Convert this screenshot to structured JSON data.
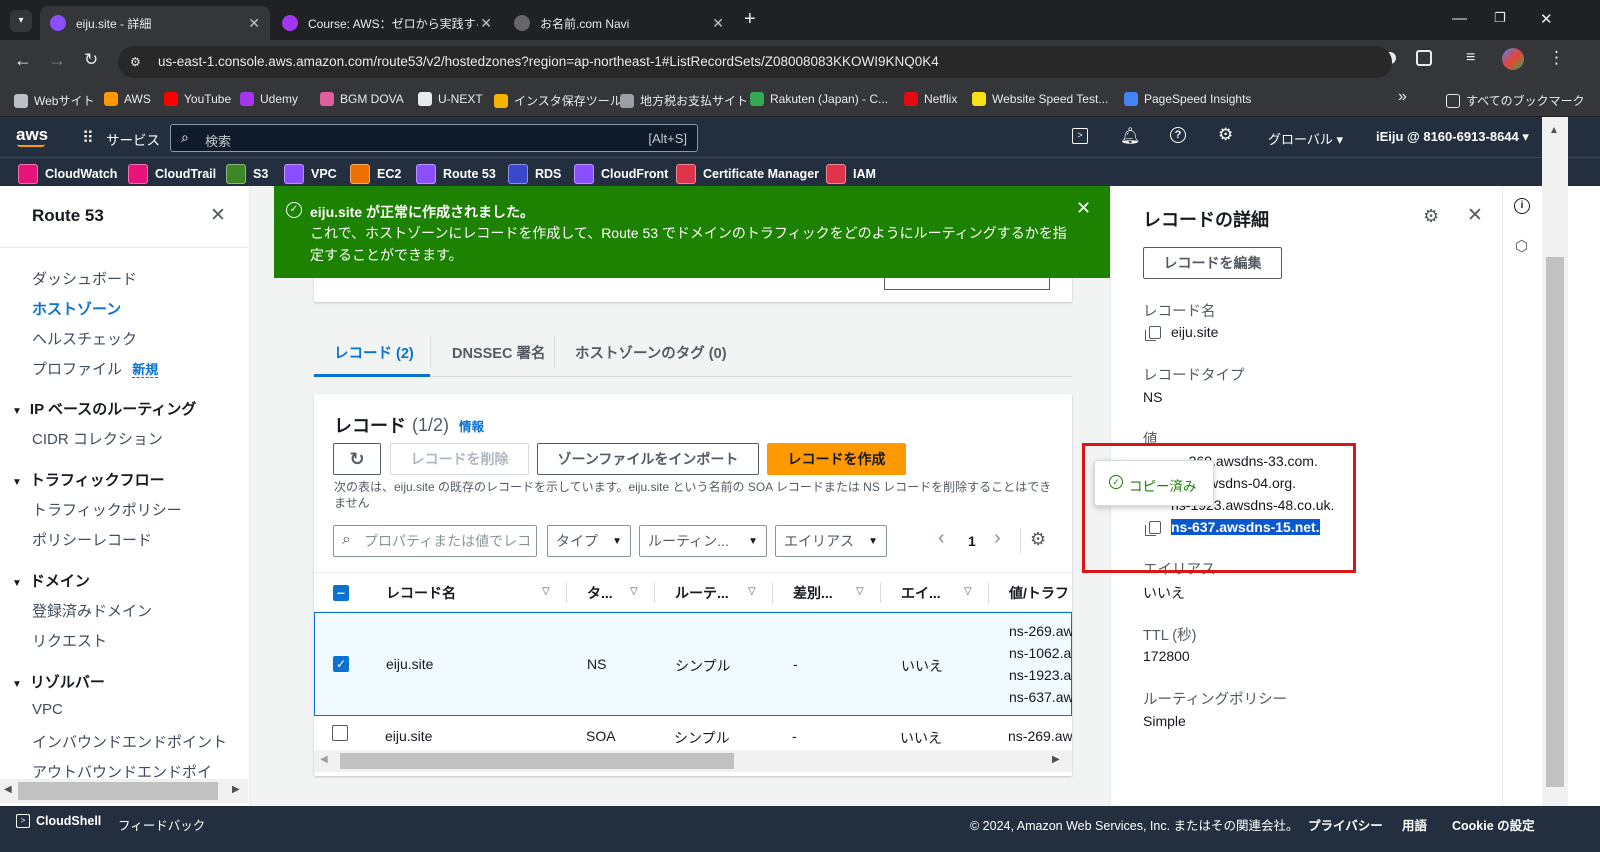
{
  "browser": {
    "tabs": [
      {
        "title": "eiju.site - 詳細",
        "color": "#8c4fff"
      },
      {
        "title": "Course: AWS：ゼロから実践するA",
        "color": "#a435f0"
      },
      {
        "title": "お名前.com Navi",
        "color": "#555"
      }
    ],
    "new_tab": "+",
    "url": "us-east-1.console.aws.amazon.com/route53/v2/hostedzones?region=ap-northeast-1#ListRecordSets/Z08008083KKOWI9KNQ0K4",
    "bookmarks": [
      {
        "label": "Webサイト",
        "color": "#bdc1c6"
      },
      {
        "label": "AWS",
        "color": "#ff9900"
      },
      {
        "label": "YouTube",
        "color": "#ff0000"
      },
      {
        "label": "Udemy",
        "color": "#a435f0"
      },
      {
        "label": "BGM DOVA",
        "color": "#e0609f"
      },
      {
        "label": "U-NEXT",
        "color": "#e8eaed"
      },
      {
        "label": "インスタ保存ツール",
        "color": "#f5b400"
      },
      {
        "label": "地方税お支払サイト",
        "color": "#9aa0a6"
      },
      {
        "label": "Rakuten (Japan) - C...",
        "color": "#34a853"
      },
      {
        "label": "Netflix",
        "color": "#e50914"
      },
      {
        "label": "Website Speed Test...",
        "color": "#f7e017"
      },
      {
        "label": "PageSpeed Insights",
        "color": "#4285f4"
      }
    ],
    "bookmarks_overflow": "»",
    "all_bookmarks": "すべてのブックマーク"
  },
  "aws": {
    "logo": "aws",
    "services_label": "サービス",
    "search_placeholder": "検索",
    "search_shortcut": "[Alt+S]",
    "region": "グローバル ▾",
    "account": "iEiju @ 8160-6913-8644 ▾",
    "favorites": [
      {
        "label": "CloudWatch",
        "color": "#e7157b"
      },
      {
        "label": "CloudTrail",
        "color": "#e7157b"
      },
      {
        "label": "S3",
        "color": "#3f8624"
      },
      {
        "label": "VPC",
        "color": "#8c4fff"
      },
      {
        "label": "EC2",
        "color": "#ed7100"
      },
      {
        "label": "Route 53",
        "color": "#8c4fff"
      },
      {
        "label": "RDS",
        "color": "#3b48cc"
      },
      {
        "label": "CloudFront",
        "color": "#8c4fff"
      },
      {
        "label": "Certificate Manager",
        "color": "#dd344c"
      },
      {
        "label": "IAM",
        "color": "#dd344c"
      }
    ]
  },
  "sidebar": {
    "title": "Route 53",
    "items": [
      "ダッシュボード",
      "ホストゾーン",
      "ヘルスチェック",
      "プロファイル"
    ],
    "new_badge": "新規",
    "sections": [
      {
        "title": "IP ベースのルーティング",
        "items": [
          "CIDR コレクション"
        ]
      },
      {
        "title": "トラフィックフロー",
        "items": [
          "トラフィックポリシー",
          "ポリシーレコード"
        ]
      },
      {
        "title": "ドメイン",
        "items": [
          "登録済みドメイン",
          "リクエスト"
        ]
      },
      {
        "title": "リゾルバー",
        "items": [
          "VPC",
          "インバウンドエンドポイント",
          "アウトバウンドエンドポイン"
        ]
      }
    ]
  },
  "flash": {
    "title": "eiju.site が正常に作成されました。",
    "body": "これで、ホストゾーンにレコードを作成して、Route 53 でドメインのトラフィックをどのようにルーティングするかを指定することができます。"
  },
  "tabs": [
    "レコード (2)",
    "DNSSEC 署名",
    "ホストゾーンのタグ (0)"
  ],
  "records": {
    "title": "レコード",
    "count": "(1/2)",
    "info": "情報",
    "refresh": "↻",
    "delete": "レコードを削除",
    "import": "ゾーンファイルをインポート",
    "create": "レコードを作成",
    "description": "次の表は、eiju.site の既存のレコードを示しています。eiju.site という名前の SOA レコードまたは NS レコードを削除することはできません",
    "filter_placeholder": "プロパティまたは値でレコ",
    "filter_type": "タイプ",
    "filter_routing": "ルーティン...",
    "filter_alias": "エイリアス",
    "page": "1",
    "columns": [
      "レコード名",
      "タ...",
      "ルーテ...",
      "差別...",
      "エイ...",
      "値/トラフ"
    ],
    "rows": [
      {
        "name": "eiju.site",
        "type": "NS",
        "routing": "シンプル",
        "diff": "-",
        "alias": "いいえ",
        "values": [
          "ns-269.aw",
          "ns-1062.a",
          "ns-1923.a",
          "ns-637.aw"
        ],
        "checked": true
      },
      {
        "name": "eiju.site",
        "type": "SOA",
        "routing": "シンプル",
        "diff": "-",
        "alias": "いいえ",
        "values": [
          "ns-269.aw"
        ],
        "checked": false
      }
    ]
  },
  "detail": {
    "title": "レコードの詳細",
    "edit": "レコードを編集",
    "name_label": "レコード名",
    "name": "eiju.site",
    "type_label": "レコードタイプ",
    "type": "NS",
    "value_label": "値",
    "values": [
      "ns-269.awsdns-33.com.",
      "ns-1062.awsdns-04.org.",
      "ns-1923.awsdns-48.co.uk.",
      "ns-637.awsdns-15.net."
    ],
    "value_visible": [
      "...269.awsdns-33.com.",
      "...2.awsdns-04.org.",
      "ns-1923.awsdns-48.co.uk."
    ],
    "copied": "コピー済み",
    "alias_label": "エイリアス",
    "alias": "いいえ",
    "ttl_label": "TTL (秒)",
    "ttl": "172800",
    "policy_label": "ルーティングポリシー",
    "policy": "Simple"
  },
  "footer": {
    "cloudshell": "CloudShell",
    "feedback": "フィードバック",
    "copyright": "© 2024, Amazon Web Services, Inc. またはその関連会社。",
    "privacy": "プライバシー",
    "terms": "用語",
    "cookie": "Cookie の設定"
  },
  "colors": {
    "accent": "#0972d3",
    "success": "#1d8102",
    "primary": "#ff9900",
    "navy": "#232f3e",
    "highlight": "#d91515"
  }
}
